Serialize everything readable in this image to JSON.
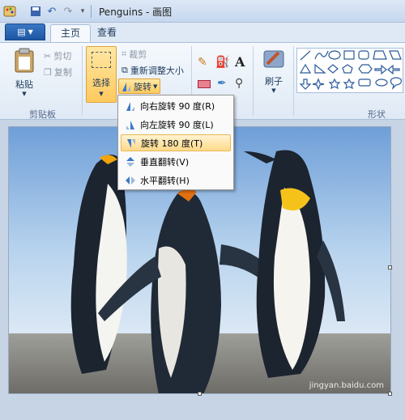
{
  "titlebar": {
    "title": "Penguins - 画图"
  },
  "tabs": [
    {
      "label": "主页"
    },
    {
      "label": "查看"
    }
  ],
  "ribbon": {
    "clipboard": {
      "paste": "粘贴",
      "cut": "剪切",
      "copy": "复制",
      "group": "剪贴板"
    },
    "image": {
      "select": "选择",
      "crop": "裁剪",
      "resize": "重新调整大小",
      "rotate": "旋转"
    },
    "brushes": {
      "label": "刷子"
    },
    "shapes": {
      "group": "形状"
    }
  },
  "rotate_menu": {
    "items": [
      {
        "label": "向右旋转 90 度(R)"
      },
      {
        "label": "向左旋转 90 度(L)"
      },
      {
        "label": "旋转 180 度(T)"
      },
      {
        "label": "垂直翻转(V)"
      },
      {
        "label": "水平翻转(H)"
      }
    ]
  },
  "watermark": "jingyan.baidu.com",
  "colors": {
    "accent": "#ffc95d",
    "ribbon": "#dfe9f5",
    "canvas_bg": "#c6d4e6"
  }
}
